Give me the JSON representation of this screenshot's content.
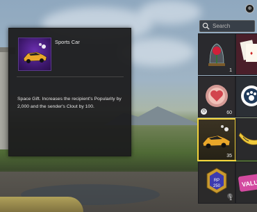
{
  "tooltip": {
    "title": "Sports Car",
    "description": "Space Gift. Increases the recipient's Popularity by 2,000 and the sender's Clout by 100."
  },
  "search": {
    "placeholder": "Search"
  },
  "items": [
    {
      "name": "rose-in-glass",
      "count": "1"
    },
    {
      "name": "playing-cards",
      "count": ""
    },
    {
      "name": "heart-orb",
      "count": "60",
      "timer": true
    },
    {
      "name": "paw-emblem",
      "count": ""
    },
    {
      "name": "sports-car",
      "count": "35",
      "selected": true
    },
    {
      "name": "banana-item",
      "count": ""
    },
    {
      "name": "rp-coin",
      "count": "1",
      "coin_text": "250"
    },
    {
      "name": "value-pack",
      "count": "",
      "label": "VALU"
    }
  ],
  "icons": {
    "timer": "clock-icon",
    "top_right": "currency-icon"
  }
}
